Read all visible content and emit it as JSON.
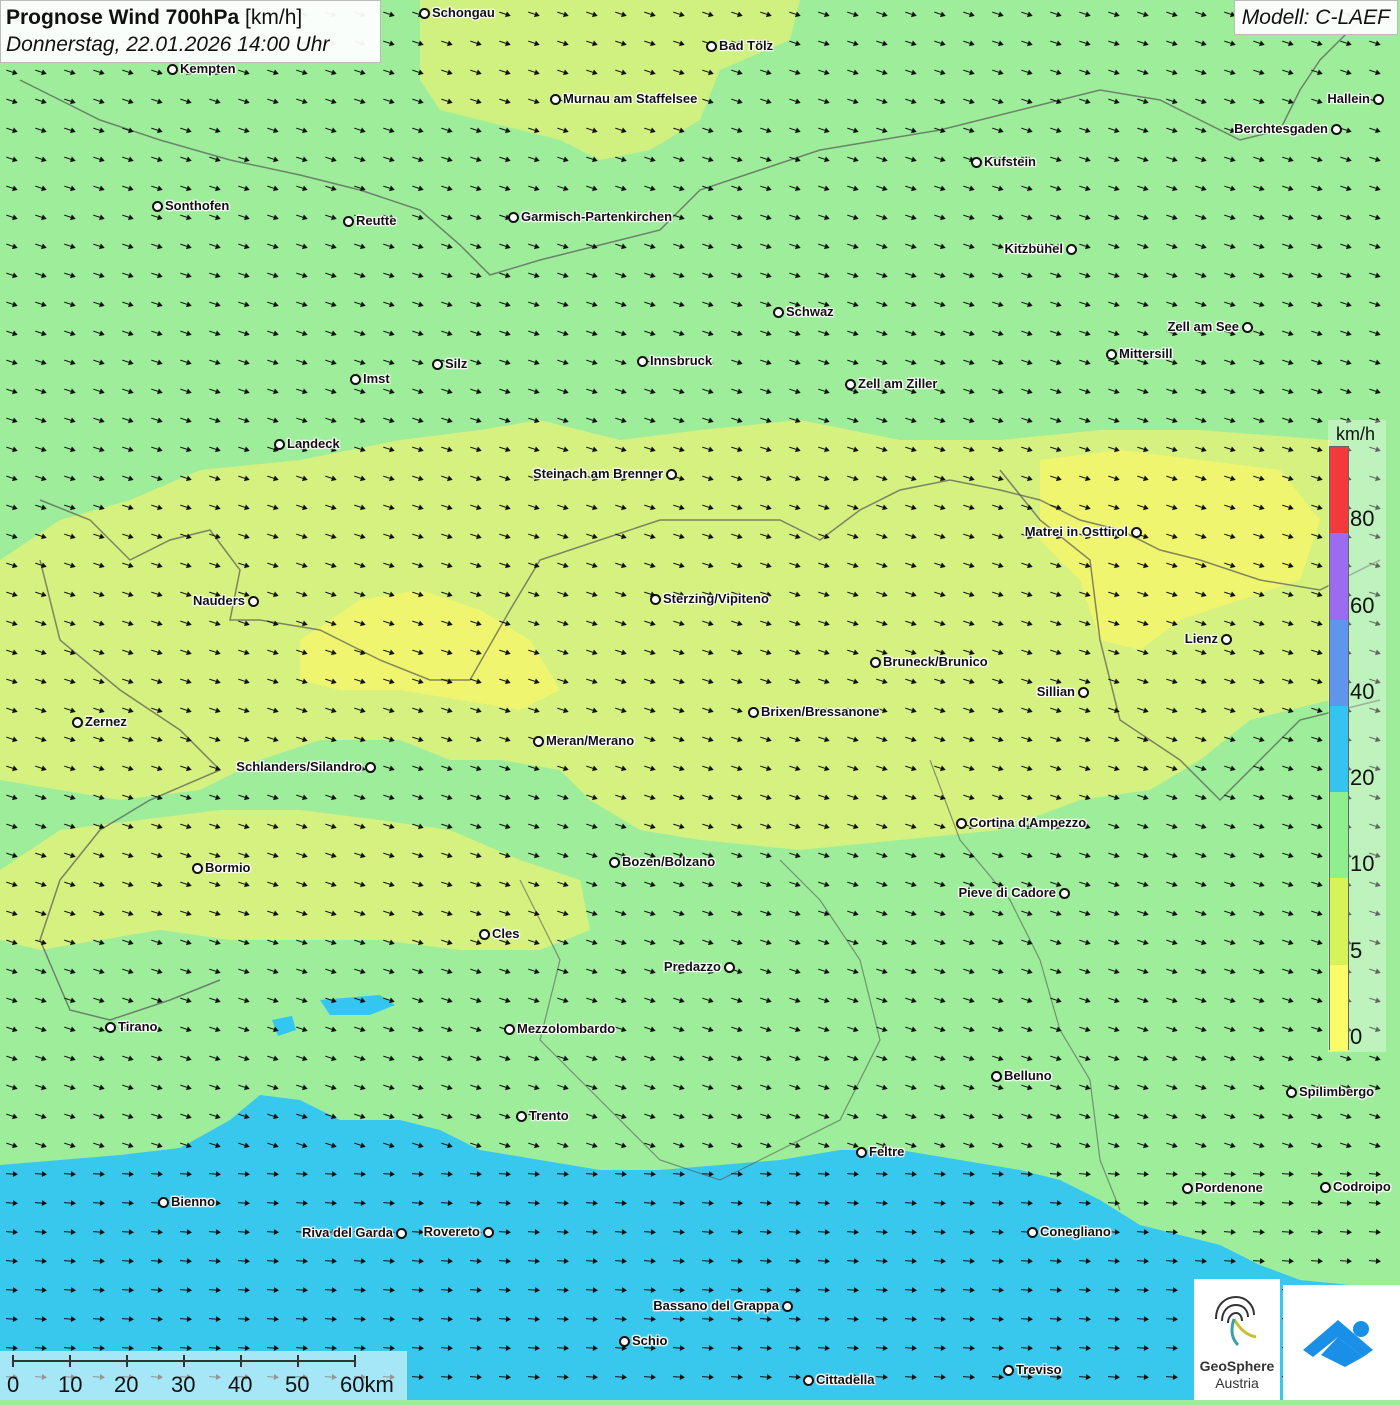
{
  "header": {
    "title": "Prognose Wind 700hPa",
    "unit": "[km/h]",
    "datetime": "Donnerstag, 22.01.2026 14:00 Uhr",
    "model": "Modell: C-LAEF"
  },
  "legend": {
    "unit": "km/h",
    "labels": [
      "80",
      "60",
      "40",
      "20",
      "10",
      "5",
      "0"
    ],
    "colors": [
      "#f23a3a",
      "#9b6cf0",
      "#5f95ec",
      "#35c4f1",
      "#8fee8e",
      "#d6f35a",
      "#fbfc6a"
    ]
  },
  "scalebar": {
    "labels": [
      "0",
      "10",
      "20",
      "30",
      "40",
      "50",
      "60km"
    ]
  },
  "branding": {
    "name_line1": "GeoSphere",
    "name_line2": "Austria"
  },
  "wind_direction": "WNW",
  "cities": [
    {
      "name": "Schongau"
    },
    {
      "name": "Bad Tölz"
    },
    {
      "name": "Kempten"
    },
    {
      "name": "Murnau am Staffelsee"
    },
    {
      "name": "Hallein"
    },
    {
      "name": "Berchtesgaden"
    },
    {
      "name": "Kufstein"
    },
    {
      "name": "Sonthofen"
    },
    {
      "name": "Reutte"
    },
    {
      "name": "Garmisch-Partenkirchen"
    },
    {
      "name": "Kitzbühel"
    },
    {
      "name": "Schwaz"
    },
    {
      "name": "Zell am See"
    },
    {
      "name": "Innsbruck"
    },
    {
      "name": "Mittersill"
    },
    {
      "name": "Silz"
    },
    {
      "name": "Imst"
    },
    {
      "name": "Zell am Ziller"
    },
    {
      "name": "Landeck"
    },
    {
      "name": "Steinach am Brenner"
    },
    {
      "name": "Matrei in Osttirol"
    },
    {
      "name": "Nauders"
    },
    {
      "name": "Sterzing/Vipiteno"
    },
    {
      "name": "Lienz"
    },
    {
      "name": "Bruneck/Brunico"
    },
    {
      "name": "Sillian"
    },
    {
      "name": "Zernez"
    },
    {
      "name": "Brixen/Bressanone"
    },
    {
      "name": "Meran/Merano"
    },
    {
      "name": "Schlanders/Silandro"
    },
    {
      "name": "Cortina d'Ampezzo"
    },
    {
      "name": "Bozen/Bolzano"
    },
    {
      "name": "Bormio"
    },
    {
      "name": "Pieve di Cadore"
    },
    {
      "name": "Cles"
    },
    {
      "name": "Predazzo"
    },
    {
      "name": "Tirano"
    },
    {
      "name": "Mezzolombardo"
    },
    {
      "name": "Belluno"
    },
    {
      "name": "Spilimbergo"
    },
    {
      "name": "Trento"
    },
    {
      "name": "Feltre"
    },
    {
      "name": "Bienno"
    },
    {
      "name": "Pordenone"
    },
    {
      "name": "Codroipo"
    },
    {
      "name": "Riva del Garda"
    },
    {
      "name": "Rovereto"
    },
    {
      "name": "Conegliano"
    },
    {
      "name": "Bassano del Grappa"
    },
    {
      "name": "Schio"
    },
    {
      "name": "Treviso"
    },
    {
      "name": "Cittadella"
    }
  ]
}
